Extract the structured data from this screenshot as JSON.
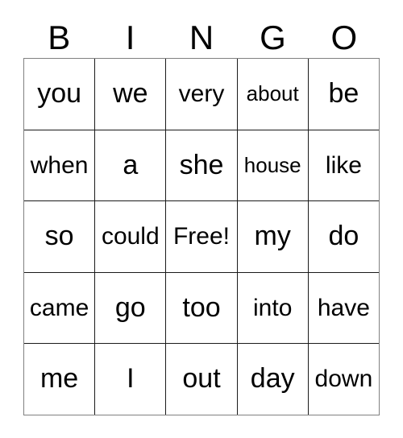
{
  "card": {
    "title_letters": [
      "B",
      "I",
      "N",
      "G",
      "O"
    ],
    "free_space_label": "Free!",
    "colors": {
      "text": "#000000",
      "cell_background": "#ffffff",
      "outer_border": "#808080",
      "inner_border": "#1a1a1a",
      "page_background": "#ffffff"
    },
    "grid": {
      "columns": 5,
      "rows": 5,
      "cells": [
        [
          {
            "text": "you"
          },
          {
            "text": "we"
          },
          {
            "text": "very"
          },
          {
            "text": "about"
          },
          {
            "text": "be"
          }
        ],
        [
          {
            "text": "when"
          },
          {
            "text": "a"
          },
          {
            "text": "she"
          },
          {
            "text": "house"
          },
          {
            "text": "like"
          }
        ],
        [
          {
            "text": "so"
          },
          {
            "text": "could"
          },
          {
            "text": "Free!"
          },
          {
            "text": "my"
          },
          {
            "text": "do"
          }
        ],
        [
          {
            "text": "came"
          },
          {
            "text": "go"
          },
          {
            "text": "too"
          },
          {
            "text": "into"
          },
          {
            "text": "have"
          }
        ],
        [
          {
            "text": "me"
          },
          {
            "text": "I"
          },
          {
            "text": "out"
          },
          {
            "text": "day"
          },
          {
            "text": "down"
          }
        ]
      ]
    }
  }
}
